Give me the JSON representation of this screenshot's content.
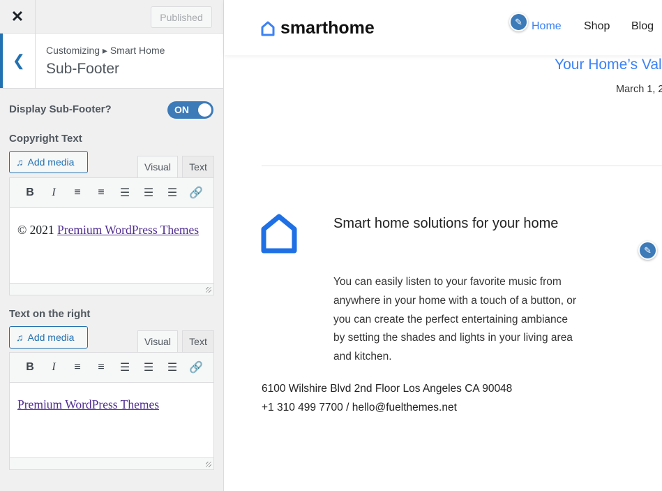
{
  "sidebar": {
    "close_label": "✕",
    "published_label": "Published",
    "breadcrumb": "Customizing ▸ Smart Home",
    "section_title": "Sub-Footer",
    "display_label": "Display Sub-Footer?",
    "toggle_label": "ON",
    "toggle_on": true,
    "copyright": {
      "label": "Copyright Text",
      "add_media": "Add media",
      "tab_visual": "Visual",
      "tab_text": "Text",
      "prefix": "© 2021 ",
      "link": "Premium WordPress Themes"
    },
    "right_text": {
      "label": "Text on the right",
      "add_media": "Add media",
      "tab_visual": "Visual",
      "tab_text": "Text",
      "link": "Premium WordPress Themes"
    }
  },
  "preview": {
    "logo": "smarthome",
    "nav": [
      "Home",
      "Shop",
      "Blog"
    ],
    "post_title": "Your Home’s Val",
    "post_date": "March 1, 2",
    "footer_heading": "Smart home solutions for your home",
    "footer_text": "You can easily listen to your favorite music from anywhere in your home with a touch of a button, or you can create the perfect entertaining ambiance by setting the shades and lights in your living area and kitchen.",
    "address": "6100 Wilshire Blvd 2nd Floor Los Angeles CA 90048",
    "contact": "+1 310 499 7700 / hello@fuelthemes.net"
  },
  "colors": {
    "accent": "#2271b1",
    "brand": "#3b82f6"
  }
}
